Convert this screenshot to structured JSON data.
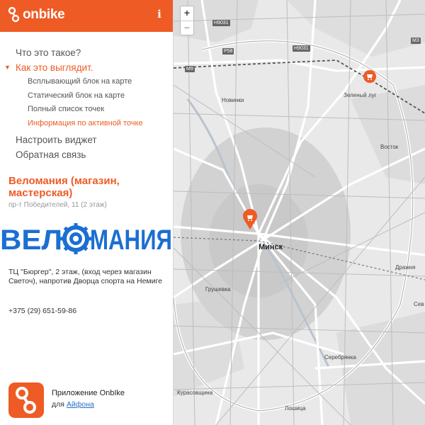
{
  "brand": {
    "logo_text": "onbike"
  },
  "nav": {
    "items": [
      {
        "label": "Что это такое?"
      },
      {
        "label": "Как это выглядит.",
        "expanded": true
      }
    ],
    "sub_items": [
      {
        "label": "Всплывающий блок на карте"
      },
      {
        "label": "Статический блок на карте"
      },
      {
        "label": "Полный список точек"
      },
      {
        "label": "Информация по активной точке",
        "active": true
      }
    ],
    "after_items": [
      {
        "label": "Настроить виджет"
      },
      {
        "label": "Обратная связь"
      }
    ]
  },
  "place": {
    "title": "Веломания (магазин, мастерская)",
    "address": "пр-т Победителей, 11 (2 этаж)",
    "logo_text": "ВЕЛОМАНИЯ",
    "description": "ТЦ \"Бюргер\", 2 этаж, (вход через магазин Светоч), напротив Дворца спорта на Немиге",
    "phone": "+375 (29) 651-59-86"
  },
  "app": {
    "title": "Приложение OnbIke",
    "prefix": "для",
    "link": "Айфона"
  },
  "map": {
    "zoom_in": "+",
    "zoom_out": "−",
    "labels": {
      "minsk": "Минск",
      "novinki": "Новинки",
      "zeleny_lug": "Зеленый луг",
      "vostok": "Восток",
      "drazhnya": "Дражня",
      "grushevka": "Грушевка",
      "seryebryanka": "Серебрянка",
      "kurasovshchina": "Курасовщина",
      "loshitsa": "Лошица",
      "sev": "Сев"
    },
    "shields": {
      "h9031_a": "H9031",
      "h9031_b": "H9031",
      "p58": "P58",
      "m3": "M3",
      "m9": "M9"
    }
  },
  "colors": {
    "accent": "#ee5b24",
    "link": "#2a6fc9",
    "velomania_blue": "#1b6fd1"
  }
}
